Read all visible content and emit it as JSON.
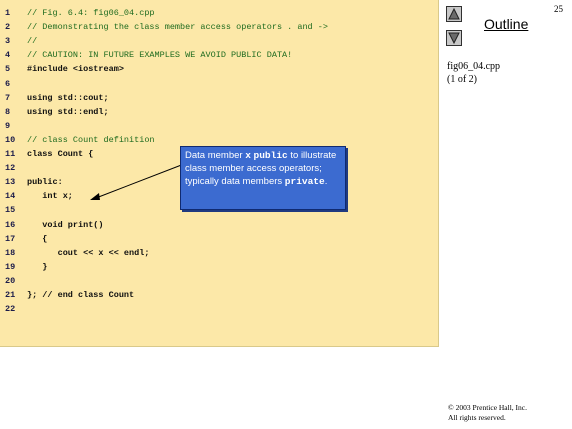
{
  "slide": {
    "page_number": "25",
    "outline_label": "Outline",
    "file_name": "fig06_04.cpp",
    "page_count": "(1 of 2)",
    "copyright": "© 2003 Prentice Hall, Inc.",
    "rights": "All rights reserved."
  },
  "nav": {
    "up_icon": "triangle-up-icon",
    "down_icon": "triangle-down-icon"
  },
  "code": {
    "lines": [
      {
        "num": "1",
        "text": "// Fig. 6.4: fig06_04.cpp",
        "kind": "comment"
      },
      {
        "num": "2",
        "text": "// Demonstrating the class member access operators . and ->",
        "kind": "comment"
      },
      {
        "num": "3",
        "text": "//",
        "kind": "comment"
      },
      {
        "num": "4",
        "text": "// CAUTION: IN FUTURE EXAMPLES WE AVOID PUBLIC DATA!",
        "kind": "comment"
      },
      {
        "num": "5",
        "text": "#include <iostream>",
        "kind": "plain"
      },
      {
        "num": "6",
        "text": "",
        "kind": "plain"
      },
      {
        "num": "7",
        "text": "using std::cout;",
        "kind": "plain"
      },
      {
        "num": "8",
        "text": "using std::endl;",
        "kind": "plain"
      },
      {
        "num": "9",
        "text": "",
        "kind": "plain"
      },
      {
        "num": "10",
        "text": "// class Count definition",
        "kind": "comment"
      },
      {
        "num": "11",
        "text": "class Count {",
        "kind": "plain"
      },
      {
        "num": "12",
        "text": "",
        "kind": "plain"
      },
      {
        "num": "13",
        "text": "public:",
        "kind": "plain"
      },
      {
        "num": "14",
        "text": "   int x;",
        "kind": "plain"
      },
      {
        "num": "15",
        "text": "",
        "kind": "plain"
      },
      {
        "num": "16",
        "text": "   void print()",
        "kind": "plain"
      },
      {
        "num": "17",
        "text": "   {",
        "kind": "plain"
      },
      {
        "num": "18",
        "text": "      cout << x << endl;",
        "kind": "plain"
      },
      {
        "num": "19",
        "text": "   }",
        "kind": "plain"
      },
      {
        "num": "20",
        "text": "",
        "kind": "plain"
      },
      {
        "num": "21",
        "text": "}; // end class Count",
        "kind": "plain"
      },
      {
        "num": "22",
        "text": "",
        "kind": "plain"
      }
    ]
  },
  "callout": {
    "part1": "Data member ",
    "part2": "x",
    "part3": " ",
    "part4": "public",
    "part5": " to illustrate class member access operators; typically data members ",
    "part6": "private",
    "part7": "."
  },
  "colors": {
    "code_background": "#fce8a8",
    "callout_background": "#3c6bd0",
    "comment_color": "#1f6b1f"
  }
}
